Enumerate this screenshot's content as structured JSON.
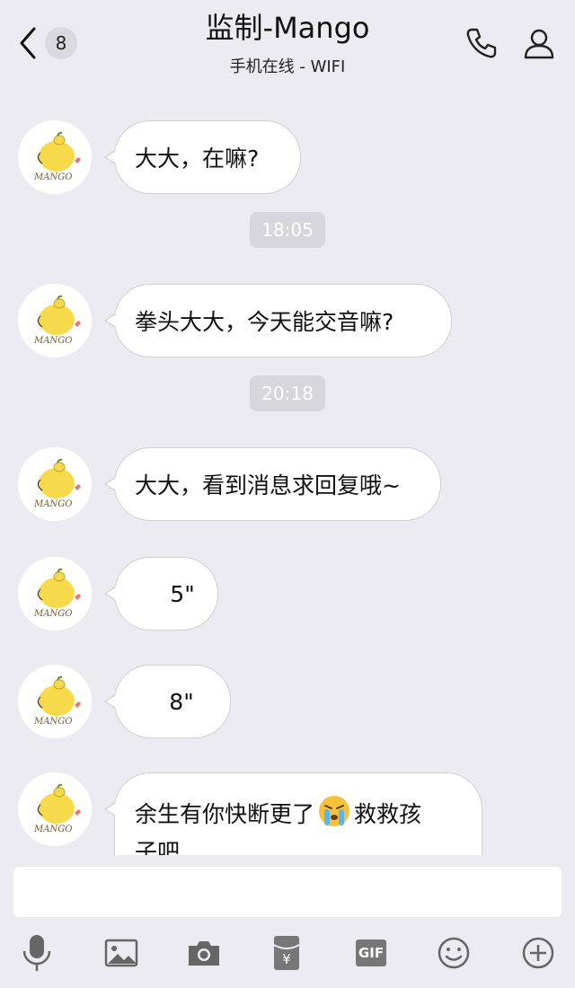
{
  "header": {
    "unread_count": "8",
    "title": "监制-Mango",
    "subtitle": "手机在线 - WIFI"
  },
  "contact": {
    "avatar_text": "MANGO"
  },
  "messages": [
    {
      "type": "text",
      "text": "大大，在嘛?"
    },
    {
      "type": "timestamp",
      "text": "18:05"
    },
    {
      "type": "text",
      "text": "拳头大大，今天能交音嘛?"
    },
    {
      "type": "timestamp",
      "text": "20:18"
    },
    {
      "type": "text",
      "text": "大大，看到消息求回复哦~"
    },
    {
      "type": "voice",
      "text": "5\""
    },
    {
      "type": "voice",
      "text": "8\""
    },
    {
      "type": "text",
      "text_before_emoji": "余生有你快断更了",
      "emoji": "crying-face",
      "text_after_emoji": "救救孩",
      "text_line2": "子吧"
    }
  ],
  "input": {
    "value": "",
    "placeholder": ""
  },
  "toolbar": {
    "items": [
      "microphone",
      "image",
      "camera",
      "red-packet",
      "gif",
      "emoji",
      "plus"
    ],
    "gif_label": "GIF",
    "red_packet_symbol": "¥"
  }
}
